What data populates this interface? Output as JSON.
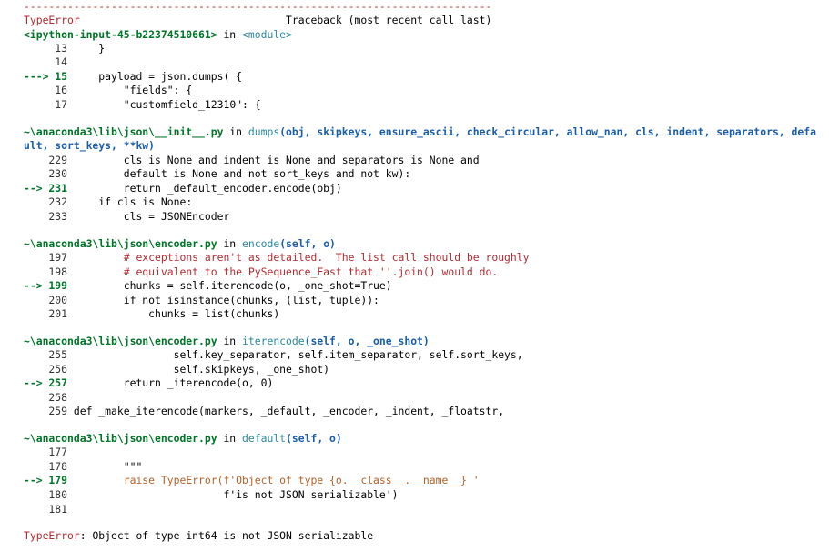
{
  "header": {
    "dashes": "---------------------------------------------------------------------------",
    "error_type": "TypeError",
    "traceback_label": "                                 Traceback (most recent call last)"
  },
  "frames": [
    {
      "file": "<ipython-input-45-b22374510661>",
      "in_word": " in ",
      "func": "<module>",
      "args": "",
      "lines": [
        {
          "prefix": "     13 ",
          "code": "    }"
        },
        {
          "prefix": "     14 ",
          "code": ""
        },
        {
          "prefix": "---> 15 ",
          "code": "    payload = json.dumps( {",
          "current": true
        },
        {
          "prefix": "     16 ",
          "code": "        \"fields\": {"
        },
        {
          "prefix": "     17 ",
          "code": "        \"customfield_12310\": {"
        }
      ]
    },
    {
      "file": "~\\anaconda3\\lib\\json\\__init__.py",
      "in_word": " in ",
      "func": "dumps",
      "args": "(obj, skipkeys, ensure_ascii, check_circular, allow_nan, cls, indent, separators, defa",
      "args_cont": "ult, sort_keys, **kw)",
      "lines": [
        {
          "prefix": "    229 ",
          "code": "        cls is None and indent is None and separators is None and"
        },
        {
          "prefix": "    230 ",
          "code": "        default is None and not sort_keys and not kw):"
        },
        {
          "prefix": "--> 231 ",
          "code": "        return _default_encoder.encode(obj)",
          "current": true
        },
        {
          "prefix": "    232 ",
          "code": "    if cls is None:"
        },
        {
          "prefix": "    233 ",
          "code": "        cls = JSONEncoder"
        }
      ]
    },
    {
      "file": "~\\anaconda3\\lib\\json\\encoder.py",
      "in_word": " in ",
      "func": "encode",
      "args": "(self, o)",
      "lines": [
        {
          "prefix": "    197 ",
          "code": "        # exceptions aren't as detailed.  The list call should be roughly"
        },
        {
          "prefix": "    198 ",
          "code": "        # equivalent to the PySequence_Fast that ''.join() would do."
        },
        {
          "prefix": "--> 199 ",
          "code": "        chunks = self.iterencode(o, _one_shot=True)",
          "current": true
        },
        {
          "prefix": "    200 ",
          "code": "        if not isinstance(chunks, (list, tuple)):"
        },
        {
          "prefix": "    201 ",
          "code": "            chunks = list(chunks)"
        }
      ]
    },
    {
      "file": "~\\anaconda3\\lib\\json\\encoder.py",
      "in_word": " in ",
      "func": "iterencode",
      "args": "(self, o, _one_shot)",
      "lines": [
        {
          "prefix": "    255 ",
          "code": "                self.key_separator, self.item_separator, self.sort_keys,"
        },
        {
          "prefix": "    256 ",
          "code": "                self.skipkeys, _one_shot)"
        },
        {
          "prefix": "--> 257 ",
          "code": "        return _iterencode(o, 0)",
          "current": true
        },
        {
          "prefix": "    258 ",
          "code": ""
        },
        {
          "prefix": "    259 ",
          "code": "def _make_iterencode(markers, _default, _encoder, _indent, _floatstr,"
        }
      ]
    },
    {
      "file": "~\\anaconda3\\lib\\json\\encoder.py",
      "in_word": " in ",
      "func": "default",
      "args": "(self, o)",
      "lines": [
        {
          "prefix": "    177 ",
          "code": ""
        },
        {
          "prefix": "    178 ",
          "code": "        \"\"\""
        },
        {
          "prefix": "--> 179 ",
          "code": "        raise TypeError(f'Object of type {o.__class__.__name__} '",
          "current": true
        },
        {
          "prefix": "    180 ",
          "code": "                        f'is not JSON serializable')"
        },
        {
          "prefix": "    181 ",
          "code": ""
        }
      ]
    }
  ],
  "final_error": {
    "type": "TypeError",
    "message": ": Object of type int64 is not JSON serializable"
  }
}
